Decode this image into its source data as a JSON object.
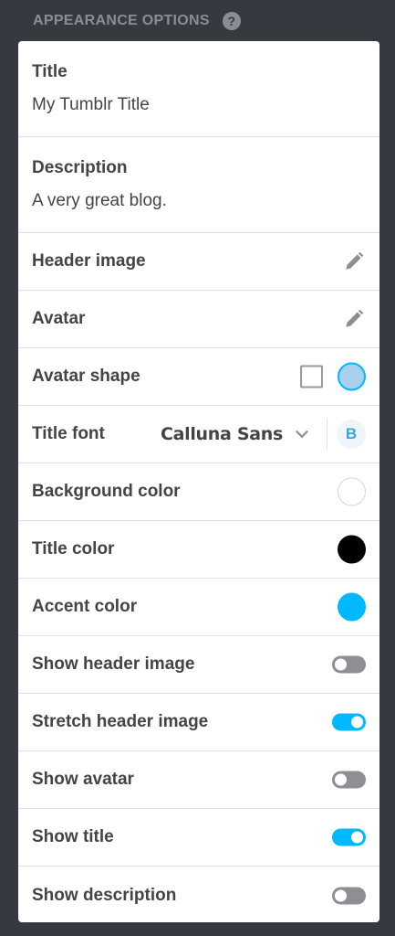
{
  "header": {
    "title": "APPEARANCE OPTIONS",
    "help": "?"
  },
  "title_field": {
    "label": "Title",
    "value": "My Tumblr Title"
  },
  "description_field": {
    "label": "Description",
    "value": "A very great blog."
  },
  "header_image": {
    "label": "Header image"
  },
  "avatar": {
    "label": "Avatar"
  },
  "avatar_shape": {
    "label": "Avatar shape",
    "selected": "circle"
  },
  "title_font": {
    "label": "Title font",
    "font": "Calluna Sans",
    "bold_label": "B"
  },
  "background_color": {
    "label": "Background color",
    "color": "#ffffff"
  },
  "title_color": {
    "label": "Title color",
    "color": "#000000"
  },
  "accent_color": {
    "label": "Accent color",
    "color": "#00b8ff"
  },
  "toggles": [
    {
      "label": "Show header image",
      "on": false
    },
    {
      "label": "Stretch header image",
      "on": true
    },
    {
      "label": "Show avatar",
      "on": false
    },
    {
      "label": "Show title",
      "on": true
    },
    {
      "label": "Show description",
      "on": false
    }
  ]
}
